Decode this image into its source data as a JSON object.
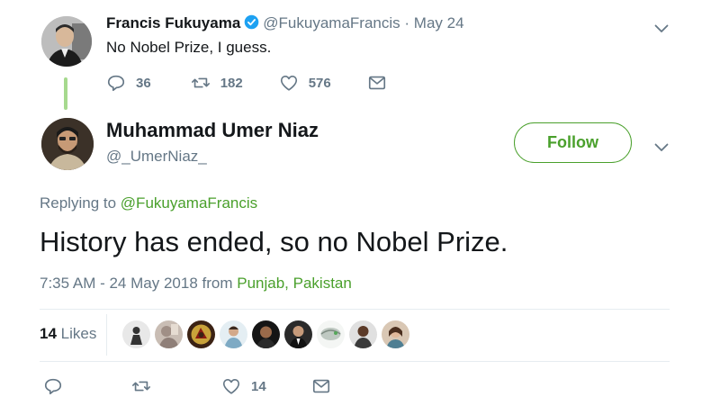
{
  "parent_tweet": {
    "name": "Francis Fukuyama",
    "handle": "@FukuyamaFrancis",
    "dot": "·",
    "date": "May 24",
    "text": "No Nobel Prize, I guess.",
    "replies": "36",
    "retweets": "182",
    "likes": "576"
  },
  "main_tweet": {
    "name": "Muhammad Umer Niaz",
    "handle": "@_UmerNiaz_",
    "follow_label": "Follow",
    "replying_prefix": "Replying to",
    "replying_handle": "@FukuyamaFrancis",
    "text": "History has ended, so no Nobel Prize.",
    "timestamp": "7:35 AM - 24 May 2018",
    "from_label": "from",
    "location": "Punjab, Pakistan",
    "likes_count": "14",
    "likes_label": "Likes",
    "likers_count": 9,
    "bottom_likes": "14"
  },
  "colors": {
    "accent": "#4aa02c",
    "muted": "#657786",
    "verified": "#1da1f2",
    "thread_line": "#a6d98e"
  },
  "icons": {
    "reply": "reply-icon",
    "retweet": "retweet-icon",
    "like": "heart-icon",
    "dm": "envelope-icon",
    "caret": "chevron-down-icon",
    "verified": "verified-badge-icon"
  }
}
